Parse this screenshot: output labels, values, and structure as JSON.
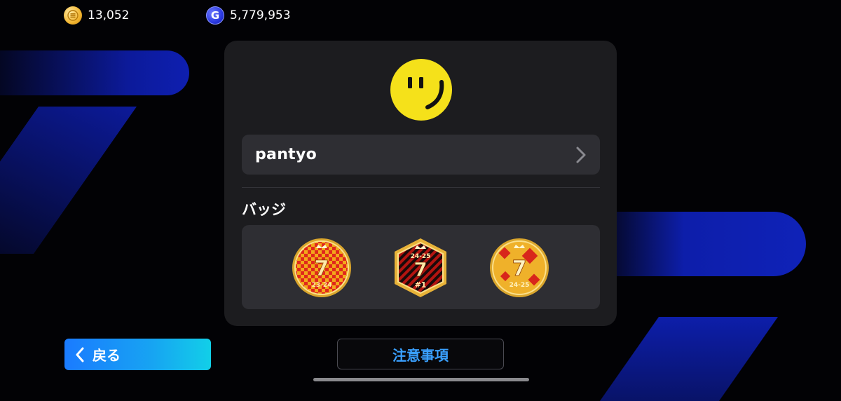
{
  "currency": {
    "coins": {
      "icon": "gold-coin-icon",
      "value": "13,052"
    },
    "gp": {
      "icon": "gp-coin-icon",
      "symbol": "G",
      "value": "5,779,953"
    }
  },
  "profile": {
    "avatar_icon": "smiley-avatar-icon",
    "name": "pantyo",
    "badges_title": "バッジ",
    "badges": [
      {
        "icon": "badge-23-24-icon",
        "number": "7",
        "season": "23-24"
      },
      {
        "icon": "badge-24-25-rank1-icon",
        "number": "7",
        "season": "24-25",
        "rank": "#1"
      },
      {
        "icon": "badge-24-25-icon",
        "number": "7",
        "season": "24-25"
      }
    ]
  },
  "footer": {
    "back_label": "戻る",
    "notes_label": "注意事項"
  },
  "colors": {
    "panel": "#1c1c1f",
    "accent_blue": "#1a7bff",
    "link_blue": "#3aa0ff",
    "avatar_yellow": "#f5e11a"
  }
}
